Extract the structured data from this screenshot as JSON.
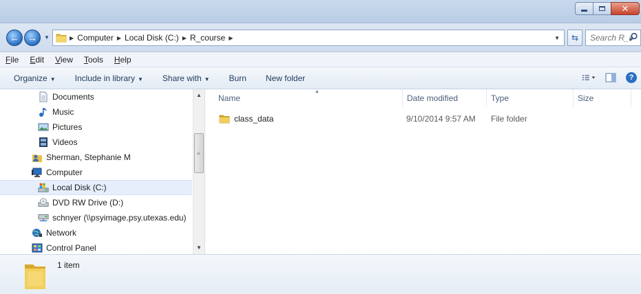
{
  "address": {
    "crumbs": [
      "Computer",
      "Local Disk (C:)",
      "R_course"
    ]
  },
  "search": {
    "placeholder": "Search R_c..."
  },
  "menu": {
    "items": [
      {
        "first": "F",
        "rest": "ile"
      },
      {
        "first": "E",
        "rest": "dit"
      },
      {
        "first": "V",
        "rest": "iew"
      },
      {
        "first": "T",
        "rest": "ools"
      },
      {
        "first": "H",
        "rest": "elp"
      }
    ]
  },
  "toolbar": {
    "organize": "Organize",
    "include": "Include in library",
    "share": "Share with",
    "burn": "Burn",
    "new_folder": "New folder"
  },
  "nav": {
    "items": [
      {
        "label": "Documents",
        "icon": "documents-icon"
      },
      {
        "label": "Music",
        "icon": "music-icon"
      },
      {
        "label": "Pictures",
        "icon": "pictures-icon"
      },
      {
        "label": "Videos",
        "icon": "videos-icon"
      },
      {
        "label": "Sherman, Stephanie M",
        "icon": "user-folder-icon"
      },
      {
        "label": "Computer",
        "icon": "computer-icon"
      },
      {
        "label": "Local Disk (C:)",
        "icon": "local-disk-icon"
      },
      {
        "label": "DVD RW Drive (D:)",
        "icon": "dvd-drive-icon"
      },
      {
        "label": "schnyer (\\\\psyimage.psy.utexas.edu)",
        "icon": "network-drive-icon"
      },
      {
        "label": "Network",
        "icon": "network-icon"
      },
      {
        "label": "Control Panel",
        "icon": "control-panel-icon"
      }
    ]
  },
  "columns": {
    "name": "Name",
    "date": "Date modified",
    "type": "Type",
    "size": "Size"
  },
  "files": [
    {
      "name": "class_data",
      "date": "9/10/2014 9:57 AM",
      "type": "File folder",
      "size": ""
    }
  ],
  "details": {
    "count": "1 item"
  }
}
